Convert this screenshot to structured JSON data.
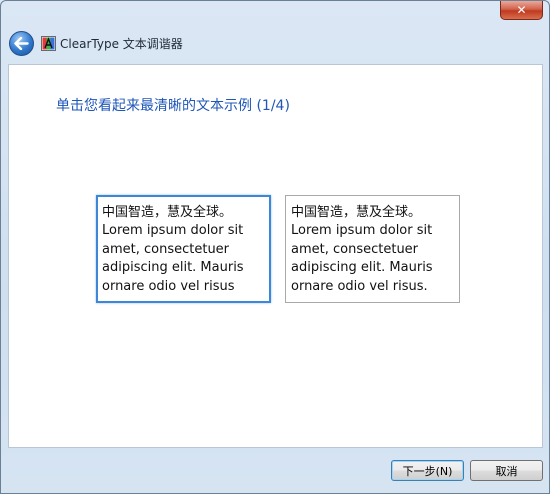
{
  "window": {
    "title": "ClearType 文本调谐器",
    "close_symbol": "✕"
  },
  "header": {
    "heading": "单击您看起来最清晰的文本示例 (1/4)"
  },
  "samples": [
    {
      "lines": [
        "中国智造，慧及全球。",
        "Lorem ipsum dolor sit",
        "amet, consectetuer",
        "adipiscing elit. Mauris",
        "ornare odio vel risus"
      ],
      "selected": true
    },
    {
      "lines": [
        "中国智造，慧及全球。",
        "Lorem ipsum dolor sit",
        "amet, consectetuer",
        "adipiscing elit. Mauris",
        "ornare odio vel risus."
      ],
      "selected": false
    }
  ],
  "footer": {
    "next_label": "下一步(N)",
    "cancel_label": "取消"
  },
  "icons": {
    "back": "back-arrow-icon",
    "app": "cleartype-icon",
    "close": "close-icon"
  },
  "colors": {
    "heading": "#1f56b8",
    "selected_border": "#3d87d6",
    "close_button": "#c0391f"
  }
}
